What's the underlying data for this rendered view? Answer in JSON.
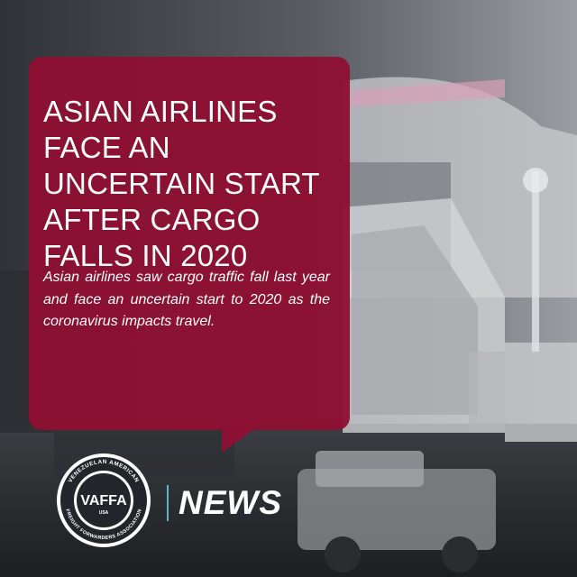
{
  "article": {
    "headline_lines": [
      "ASIAN AIRLINES",
      "FACE AN",
      "UNCERTAIN START",
      "AFTER CARGO",
      "FALLS IN 2020"
    ],
    "summary": "Asian airlines saw cargo traffic fall last year and face an uncertain start to 2020 as the coronavirus impacts travel."
  },
  "branding": {
    "logo_text": "VAFFA",
    "logo_subtext": "USA",
    "logo_ring_top": "VENEZUELAN AMERICAN",
    "logo_ring_bottom": "FREIGHT FORWARDERS ASSOCIATION",
    "section_label": "NEWS"
  },
  "colors": {
    "card": "#8e1031",
    "divider": "#5fb4c7",
    "text": "#ffffff"
  }
}
